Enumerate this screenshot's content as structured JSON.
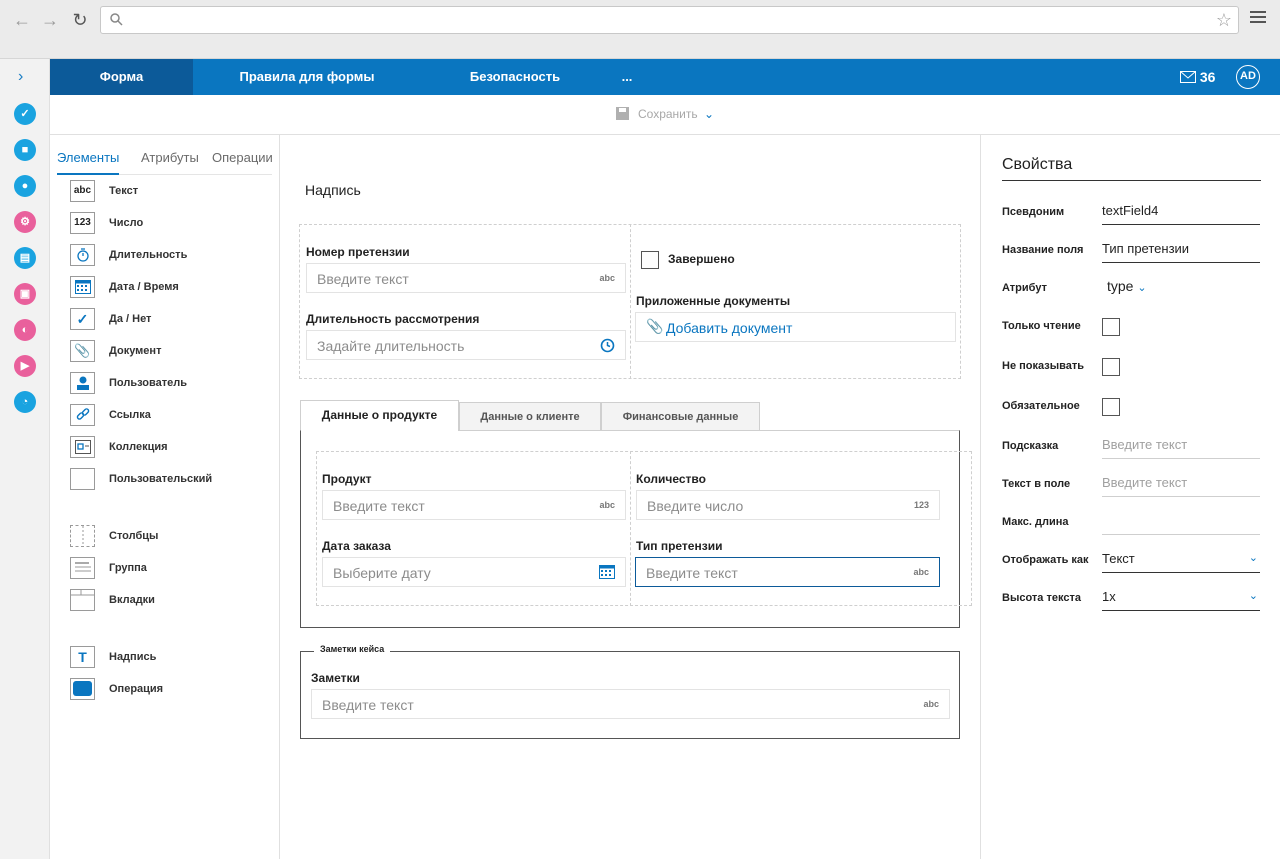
{
  "topbar": {
    "tabs": [
      "Форма",
      "Правила для формы",
      "Безопасность",
      "..."
    ],
    "mail_count": "36",
    "avatar": "AD"
  },
  "toolbar": {
    "save_label": "Сохранить"
  },
  "left": {
    "tabs": [
      "Элементы",
      "Атрибуты",
      "Операции"
    ],
    "elements": [
      {
        "icon_text": "abc",
        "label": "Текст"
      },
      {
        "icon_text": "123",
        "label": "Число"
      },
      {
        "icon_text": "",
        "label": "Длительность"
      },
      {
        "icon_text": "",
        "label": "Дата / Время"
      },
      {
        "icon_text": "",
        "label": "Да / Нет"
      },
      {
        "icon_text": "",
        "label": "Документ"
      },
      {
        "icon_text": "",
        "label": "Пользователь"
      },
      {
        "icon_text": "",
        "label": "Ссылка"
      },
      {
        "icon_text": "",
        "label": "Коллекция"
      },
      {
        "icon_text": "",
        "label": "Пользовательский"
      }
    ],
    "layout_elements": [
      {
        "label": "Столбцы"
      },
      {
        "label": "Группа"
      },
      {
        "label": "Вкладки"
      }
    ],
    "other_elements": [
      {
        "icon_text": "T",
        "label": "Надпись"
      },
      {
        "icon_text": "",
        "label": "Операция"
      }
    ]
  },
  "form": {
    "caption": "Надпись",
    "claim_number_label": "Номер претензии",
    "claim_number_placeholder": "Введите текст",
    "claim_number_suffix": "abc",
    "duration_label": "Длительность рассмотрения",
    "duration_placeholder": "Задайте длительность",
    "completed_label": "Завершено",
    "docs_label": "Приложенные документы",
    "add_doc": "Добавить документ",
    "tabs": [
      "Данные о продукте",
      "Данные о клиенте",
      "Финансовые данные"
    ],
    "product_label": "Продукт",
    "product_placeholder": "Введите текст",
    "product_suffix": "abc",
    "qty_label": "Количество",
    "qty_placeholder": "Введите число",
    "qty_suffix": "123",
    "order_date_label": "Дата заказа",
    "order_date_placeholder": "Выберите дату",
    "claim_type_label": "Тип претензии",
    "claim_type_placeholder": "Введите текст",
    "claim_type_suffix": "abc",
    "notes_group_title": "Заметки кейса",
    "notes_label": "Заметки",
    "notes_placeholder": "Введите текст",
    "notes_suffix": "abc"
  },
  "properties": {
    "title": "Свойства",
    "alias_label": "Псевдоним",
    "alias_value": "textField4",
    "field_name_label": "Название поля",
    "field_name_value": "Тип претензии",
    "attribute_label": "Атрибут",
    "attribute_value": "type",
    "readonly_label": "Только чтение",
    "hidden_label": "Не показывать",
    "required_label": "Обязательное",
    "hint_label": "Подсказка",
    "hint_placeholder": "Введите текст",
    "field_text_label": "Текст в поле",
    "field_text_placeholder": "Введите текст",
    "max_length_label": "Макс. длина",
    "display_as_label": "Отображать как",
    "display_as_value": "Текст",
    "text_height_label": "Высота текста",
    "text_height_value": "1x"
  },
  "colors": {
    "brand": "#0a76c0",
    "brand_dark": "#0c5a99"
  }
}
